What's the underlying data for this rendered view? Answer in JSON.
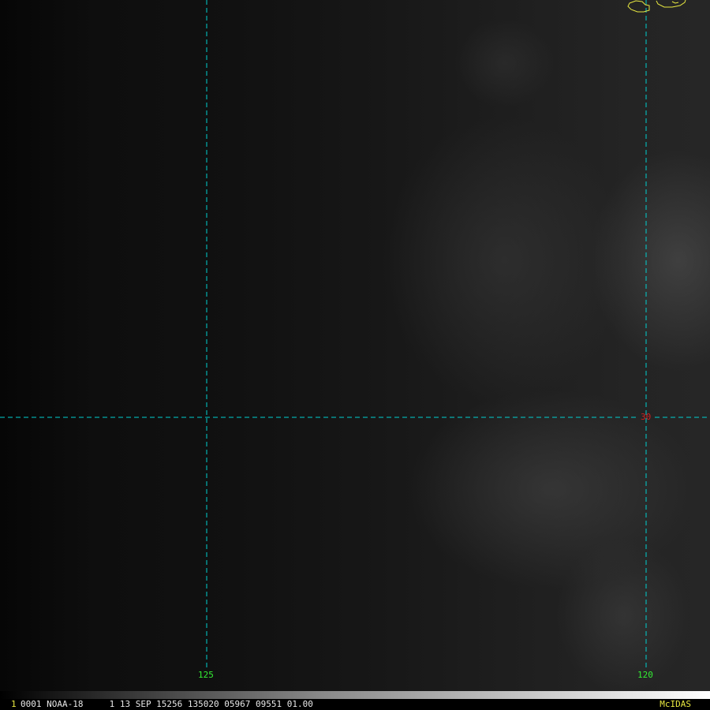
{
  "map": {
    "grid_color": "#00d0d0",
    "coastline_color": "#e8e840",
    "longitude_labels": [
      "125",
      "120"
    ],
    "latitude_labels": [
      "30"
    ]
  },
  "status_bar": {
    "frame_number": "1",
    "text": "0001 NOAA-18     1 13 SEP 15256 135020 05967 09551 01.00",
    "brand": "McIDAS"
  }
}
